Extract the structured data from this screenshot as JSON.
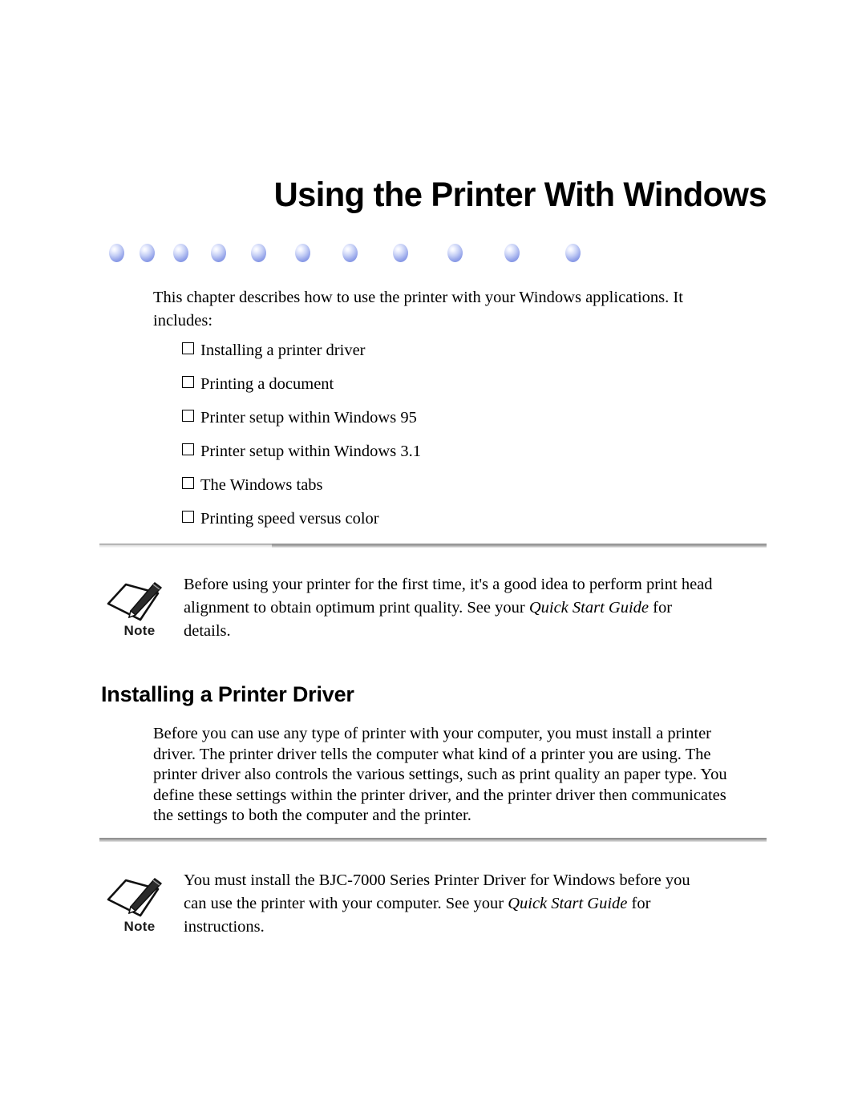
{
  "document": {
    "chapter_title": "Using the Printer With Windows",
    "intro_paragraph": "This chapter describes how to use the printer with your Windows applications. It includes:",
    "checklist": [
      {
        "label": "Installing a printer driver"
      },
      {
        "label": "Printing a document"
      },
      {
        "label": "Printer setup within Windows 95"
      },
      {
        "label": "Printer setup within Windows 3.1"
      },
      {
        "label": "The Windows tabs"
      },
      {
        "label": "Printing speed versus color"
      }
    ],
    "note_one": {
      "caption": "Note",
      "text_part_1": "Before using your printer for the first time, it's a good idea to perform print head alignment to obtain optimum print quality. See your ",
      "text_italic": "Quick Start Guide",
      "text_part_2": " for details."
    },
    "section_heading": "Installing a Printer Driver",
    "section_paragraph": "Before you can use any type of printer with your computer, you must install a printer driver. The printer driver tells the computer what kind of a printer you are using. The printer driver also controls the various settings, such as print quality an paper type. You define these settings within the printer driver, and the printer driver then communicates the settings to both the computer and the printer.",
    "note_two": {
      "caption": "Note",
      "text_part_1": "You must install the BJC-7000 Series Printer Driver for Windows before you can use the printer with your computer. See your ",
      "text_italic": "Quick Start Guide",
      "text_part_2": " for instructions."
    },
    "decor": {
      "dot_count": 11,
      "dot_color": "#8c9ce6",
      "dot_highlight": "#ffffff"
    },
    "rule_colors": {
      "light": "#e2e2e2",
      "dark": "#a8a8a8"
    }
  }
}
